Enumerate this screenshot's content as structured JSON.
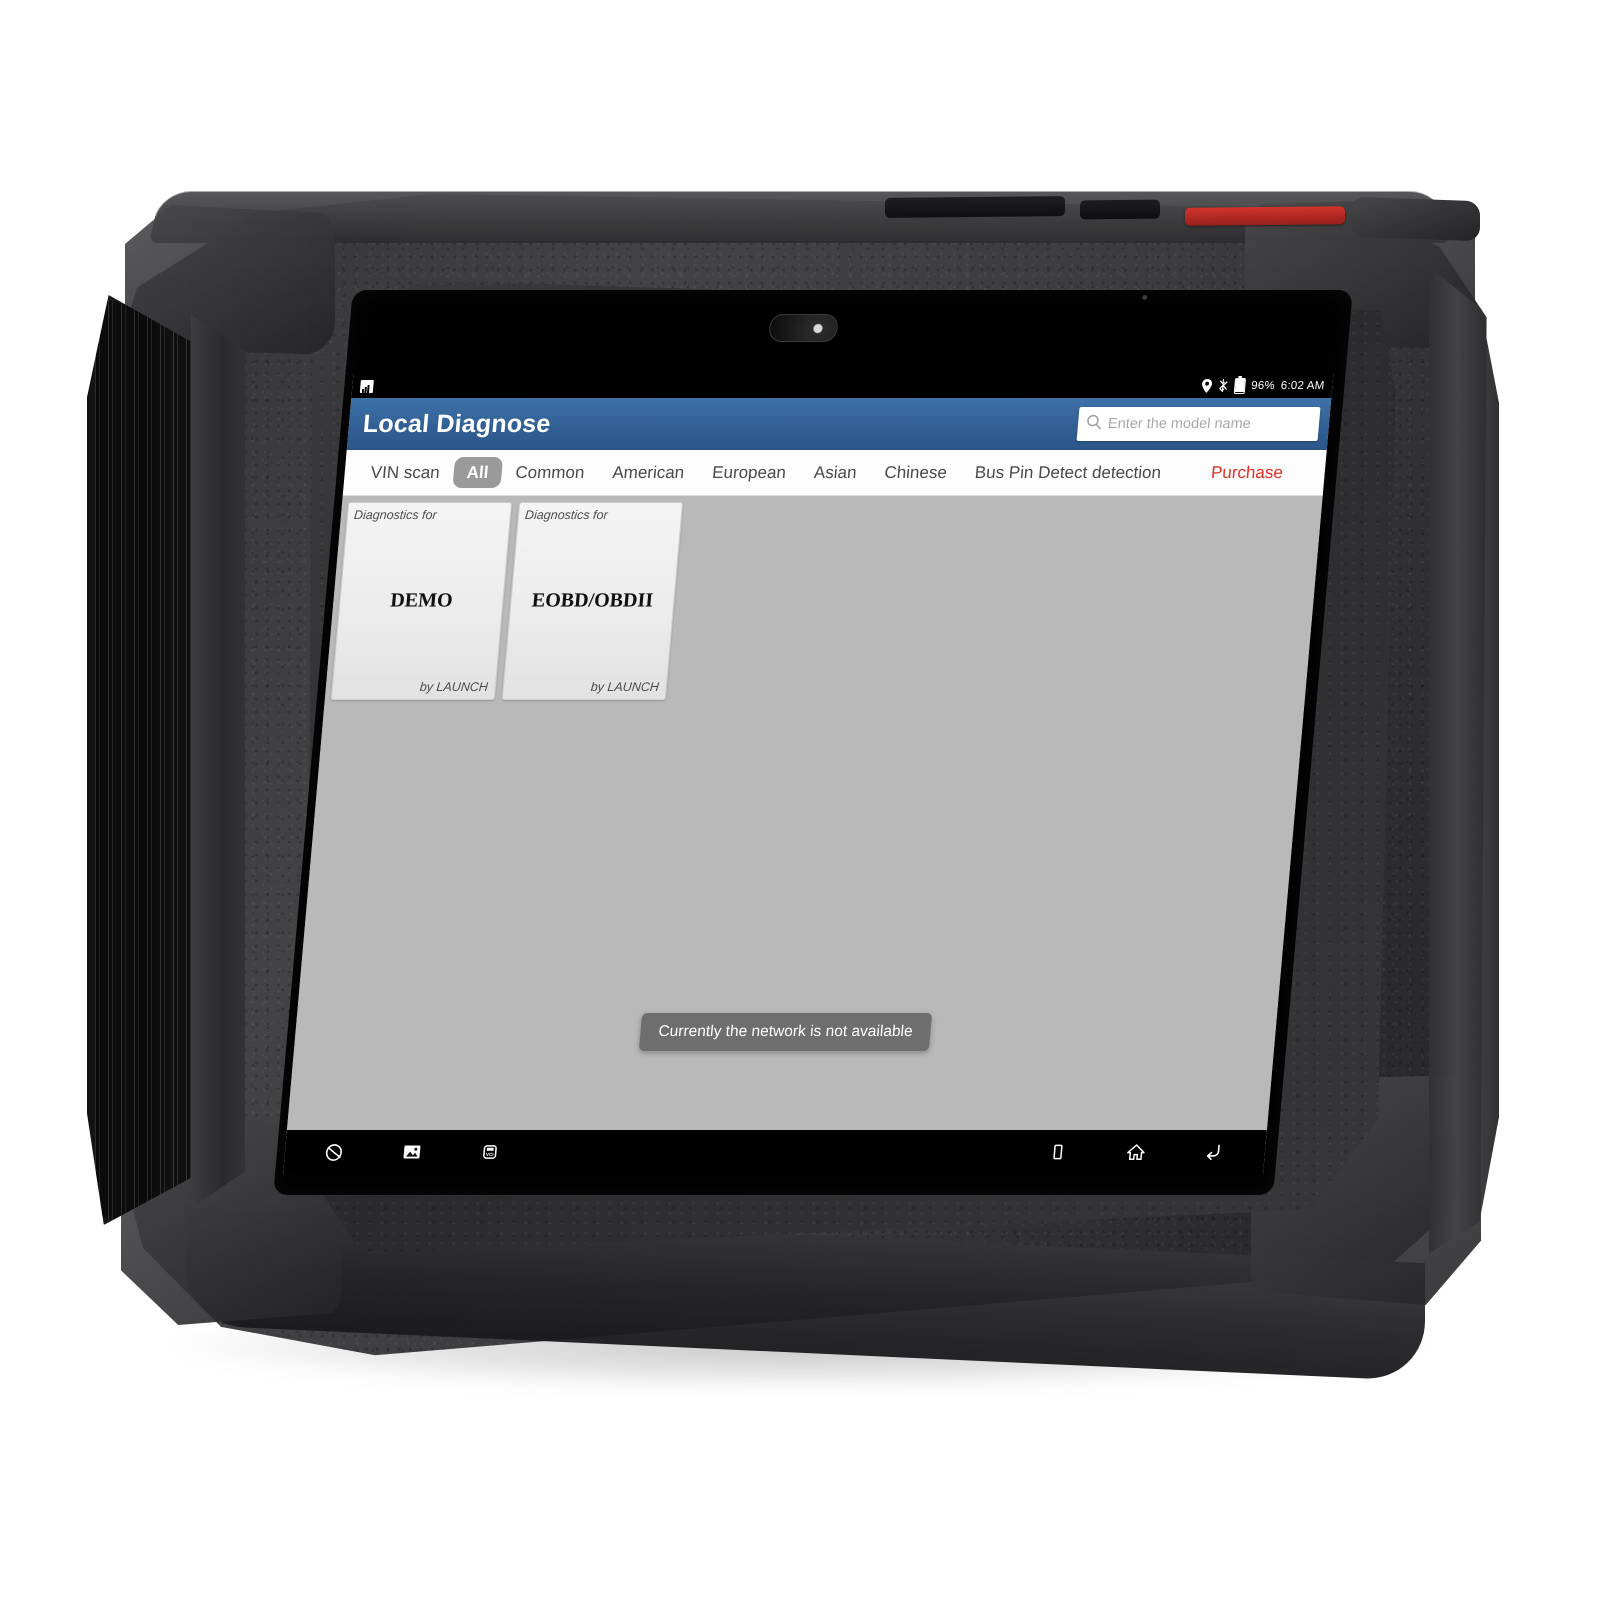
{
  "device": {
    "name": "LAUNCH rugged diagnostic tablet",
    "hardware": {
      "camera": "front-camera",
      "power_button": "power-button",
      "volume_buttons": "volume-buttons",
      "grip": "rubber-side-grip"
    }
  },
  "statusbar": {
    "notification_icon": "sd-card-icon",
    "location_icon": "location-pin-icon",
    "bluetooth_icon": "bluetooth-icon",
    "battery_icon": "battery-icon",
    "battery_text": "96%",
    "time": "6:02 AM"
  },
  "appbar": {
    "title": "Local Diagnose",
    "search": {
      "icon": "search-icon",
      "placeholder": "Enter the model name",
      "value": ""
    }
  },
  "tabs": [
    {
      "label": "VIN scan",
      "active": false,
      "style": "normal"
    },
    {
      "label": "All",
      "active": true,
      "style": "normal"
    },
    {
      "label": "Common",
      "active": false,
      "style": "normal"
    },
    {
      "label": "American",
      "active": false,
      "style": "normal"
    },
    {
      "label": "European",
      "active": false,
      "style": "normal"
    },
    {
      "label": "Asian",
      "active": false,
      "style": "normal"
    },
    {
      "label": "Chinese",
      "active": false,
      "style": "normal"
    },
    {
      "label": "Bus Pin Detect detection",
      "active": false,
      "style": "normal"
    },
    {
      "label": "Purchase",
      "active": false,
      "style": "purchase"
    }
  ],
  "tiles": [
    {
      "header": "Diagnostics for",
      "name": "DEMO",
      "footer": "by LAUNCH"
    },
    {
      "header": "Diagnostics for",
      "name": "EOBD/OBDII",
      "footer": "by LAUNCH"
    }
  ],
  "toast": {
    "message": "Currently the network is not available"
  },
  "navbar": {
    "left": [
      {
        "icon": "browser-globe-icon",
        "label": "Browser"
      },
      {
        "icon": "gallery-image-icon",
        "label": "Gallery"
      },
      {
        "icon": "vci-connector-icon",
        "label": "VCI"
      }
    ],
    "right": [
      {
        "icon": "recent-apps-icon",
        "label": "Recents"
      },
      {
        "icon": "home-icon",
        "label": "Home"
      },
      {
        "icon": "back-arrow-icon",
        "label": "Back"
      }
    ]
  },
  "colors": {
    "appbar_blue": "#315f94",
    "tab_active_gray": "#9a9a9a",
    "purchase_red": "#e03127",
    "content_gray": "#b9b9b9",
    "toast_gray": "#696969",
    "tile_face": "#eeeeee"
  }
}
